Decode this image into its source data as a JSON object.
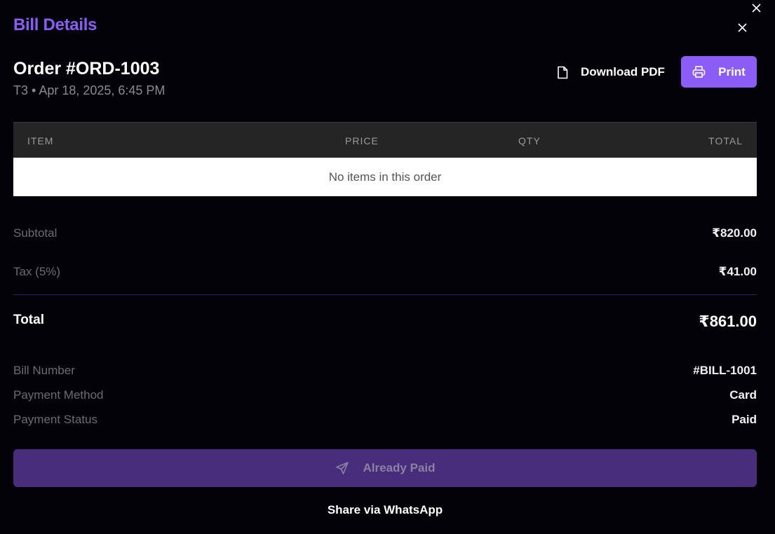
{
  "dialog": {
    "title": "Bill Details",
    "close_icon": "close-icon",
    "outer_close_icon": "close-icon"
  },
  "order": {
    "title": "Order #ORD-1003",
    "subtitle": "T3 • Apr 18, 2025, 6:45 PM"
  },
  "actions": {
    "download_label": "Download PDF",
    "download_icon": "document-icon",
    "print_label": "Print",
    "print_icon": "printer-icon"
  },
  "table": {
    "headers": [
      "ITEM",
      "PRICE",
      "QTY",
      "TOTAL"
    ],
    "empty_text": "No items in this order"
  },
  "summary": {
    "subtotal_label": "Subtotal",
    "subtotal_value": "₹820.00",
    "tax_label": "Tax (5%)",
    "tax_value": "₹41.00",
    "total_label": "Total",
    "total_value": "₹861.00"
  },
  "bill_info": [
    {
      "label": "Bill Number",
      "value": "#BILL-1001"
    },
    {
      "label": "Payment Method",
      "value": "Card"
    },
    {
      "label": "Payment Status",
      "value": "Paid"
    }
  ],
  "footer": {
    "paid_button_label": "Already Paid",
    "paid_button_icon": "send-icon",
    "share_label": "Share via WhatsApp"
  },
  "colors": {
    "accent": "#8b5cf6",
    "background": "#030208",
    "paid_button": "#472d7c"
  }
}
